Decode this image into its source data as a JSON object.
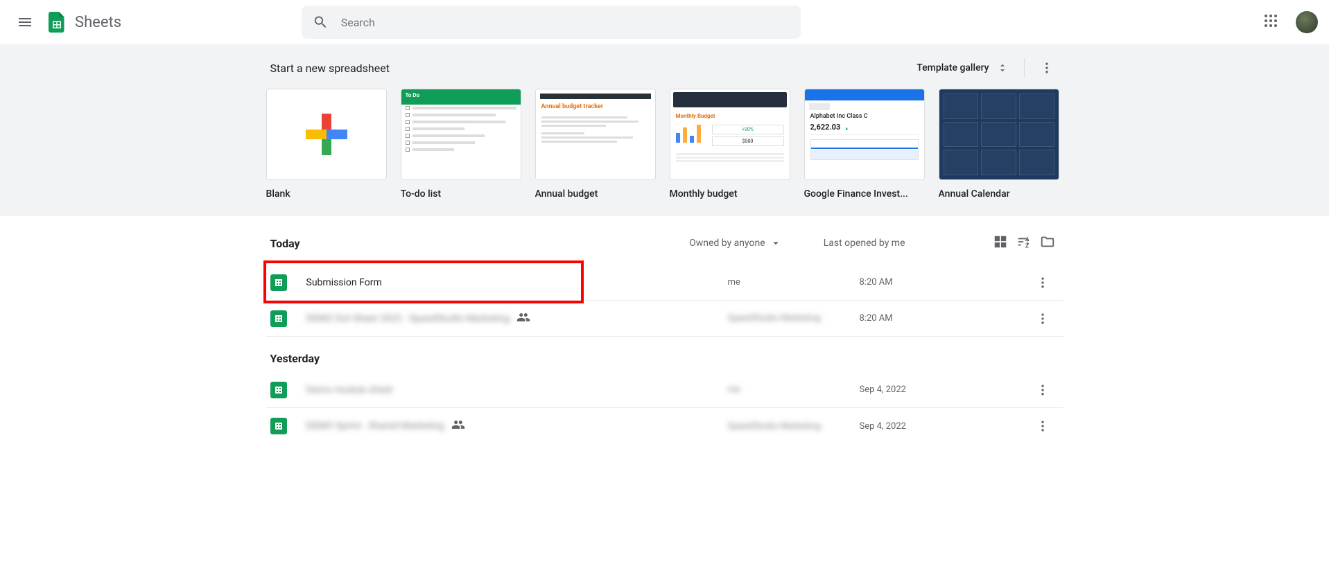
{
  "header": {
    "app_name": "Sheets",
    "search_placeholder": "Search"
  },
  "templates": {
    "section_title": "Start a new spreadsheet",
    "gallery_label": "Template gallery",
    "items": [
      {
        "label": "Blank"
      },
      {
        "label": "To-do list"
      },
      {
        "label": "Annual budget"
      },
      {
        "label": "Monthly budget"
      },
      {
        "label": "Google Finance Invest..."
      },
      {
        "label": "Annual Calendar"
      }
    ],
    "thumb_text": {
      "todo_header": "To Do",
      "annual_budget_title": "Annual budget tracker",
      "monthly_budget_title": "Monthly Budget",
      "finance_title": "Alphabet Inc Class C",
      "finance_value": "2,622.03"
    }
  },
  "filters": {
    "owned": "Owned by anyone",
    "sort": "Last opened by me"
  },
  "groups": [
    {
      "label": "Today",
      "rows": [
        {
          "name": "Submission Form",
          "owner": "me",
          "date": "8:20 AM",
          "shared": false,
          "blurred": false,
          "highlighted": true
        },
        {
          "name": "DEMO Dot Sheet 2022 - SpeedStudio Marketing",
          "owner": "SpeedStudio Marketing",
          "date": "8:20 AM",
          "shared": true,
          "blurred": true,
          "highlighted": false
        }
      ]
    },
    {
      "label": "Yesterday",
      "rows": [
        {
          "name": "Demo module sheet",
          "owner": "me",
          "date": "Sep 4, 2022",
          "shared": false,
          "blurred": true,
          "highlighted": false
        },
        {
          "name": "DEMO Sprint - Shared Marketing",
          "owner": "SpeedStudio Marketing",
          "date": "Sep 4, 2022",
          "shared": true,
          "blurred": true,
          "highlighted": false
        }
      ]
    }
  ]
}
